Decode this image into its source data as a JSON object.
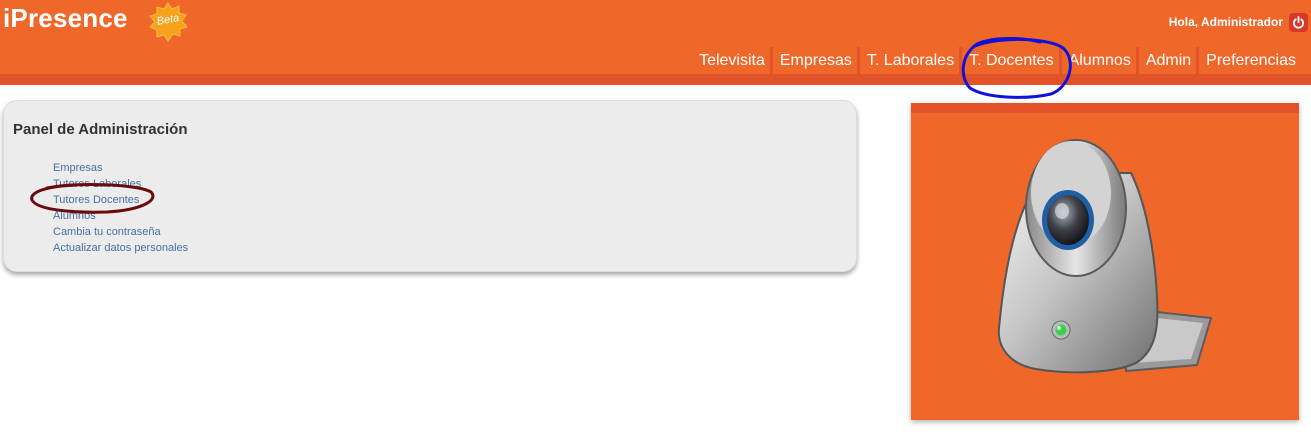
{
  "app": {
    "title": "iPresence",
    "beta_badge": "Beta"
  },
  "header": {
    "greeting": "Hola, Administrador",
    "logout_icon": "power-icon"
  },
  "nav": {
    "items": [
      {
        "label": "Televisita"
      },
      {
        "label": "Empresas"
      },
      {
        "label": "T. Laborales"
      },
      {
        "label": "T. Docentes"
      },
      {
        "label": "Alumnos"
      },
      {
        "label": "Admin"
      },
      {
        "label": "Preferencias"
      }
    ]
  },
  "panel": {
    "title": "Panel de Administración",
    "links": [
      {
        "label": "Empresas"
      },
      {
        "label": "Tutores Laborales"
      },
      {
        "label": "Tutores Docentes"
      },
      {
        "label": "Alumnos"
      },
      {
        "label": "Cambia tu contraseña"
      },
      {
        "label": "Actualizar datos personales"
      }
    ]
  },
  "illustration": {
    "icon": "webcam-icon"
  },
  "colors": {
    "brand_orange": "#f0672a",
    "dark_orange": "#e2532a",
    "link_blue": "#4a6fa5",
    "annotation_blue": "#1010d8",
    "annotation_maroon": "#6b0a0a"
  }
}
